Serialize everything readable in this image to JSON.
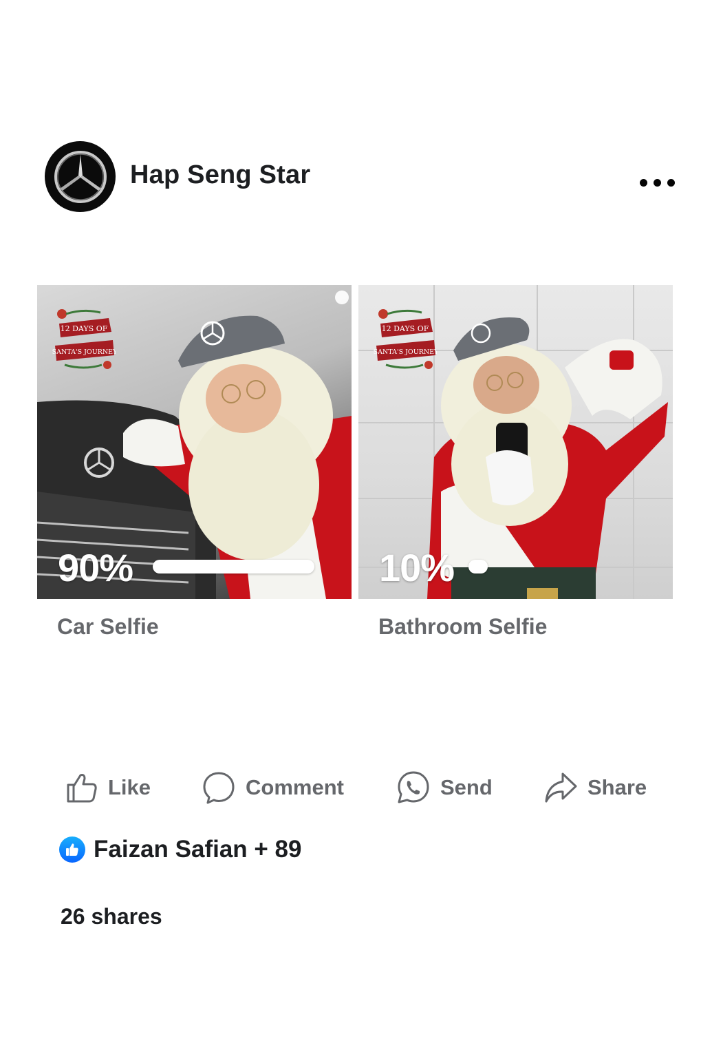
{
  "post": {
    "page_name": "Hap Seng Star",
    "avatar_icon": "mercedes-star-logo",
    "more_icon": "more-horizontal-icon"
  },
  "poll": {
    "options": [
      {
        "label": "Car Selfie",
        "percent_text": "90%",
        "percent": 90
      },
      {
        "label": "Bathroom Selfie",
        "percent_text": "10%",
        "percent": 10
      }
    ],
    "badge_text": [
      "12 DAYS OF",
      "SANTA'S JOURNEY"
    ]
  },
  "actions": {
    "like": "Like",
    "comment": "Comment",
    "send": "Send",
    "share": "Share"
  },
  "reactions": {
    "text": "Faizan Safian + 89"
  },
  "shares": {
    "text": "26 shares"
  },
  "colors": {
    "secondary_text": "#65676b",
    "like_blue": "#0866ff"
  }
}
